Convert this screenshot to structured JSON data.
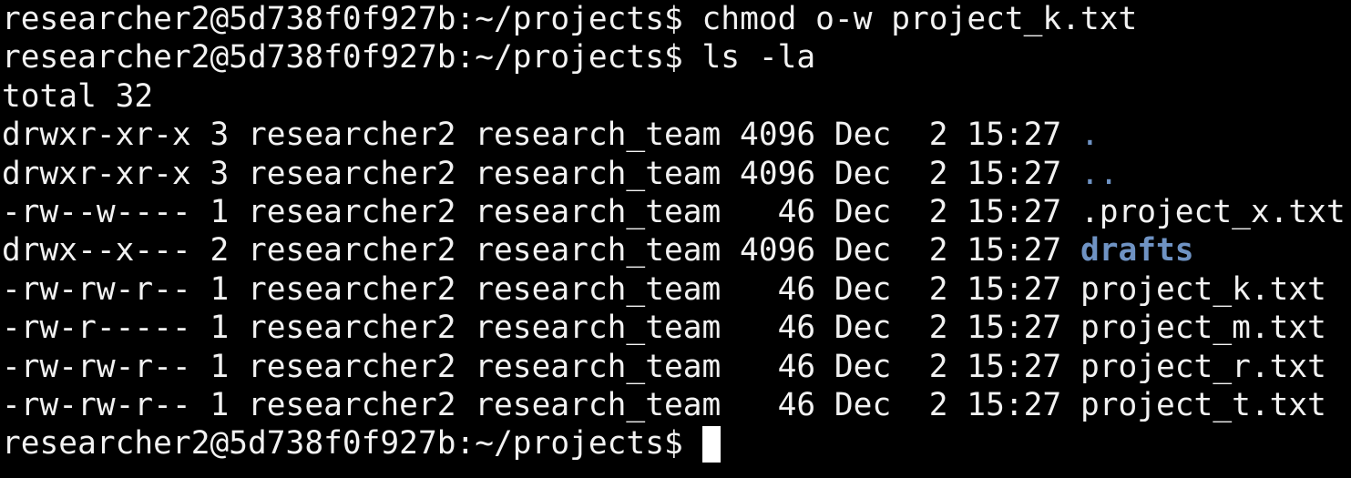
{
  "terminal": {
    "prompt": "researcher2@5d738f0f927b:~/projects$ ",
    "history": [
      {
        "command": "chmod o-w project_k.txt"
      },
      {
        "command": "ls -la"
      }
    ],
    "total_line": "total 32",
    "listing": [
      {
        "prefix": "drwxr-xr-x 3 researcher2 research_team 4096 Dec  2 15:27 ",
        "name": "."
      },
      {
        "prefix": "drwxr-xr-x 3 researcher2 research_team 4096 Dec  2 15:27 ",
        "name": ".."
      },
      {
        "prefix": "-rw--w---- 1 researcher2 research_team   46 Dec  2 15:27 ",
        "name": ".project_x.txt"
      },
      {
        "prefix": "drwx--x--- 2 researcher2 research_team 4096 Dec  2 15:27 ",
        "name": "drafts"
      },
      {
        "prefix": "-rw-rw-r-- 1 researcher2 research_team   46 Dec  2 15:27 ",
        "name": "project_k.txt"
      },
      {
        "prefix": "-rw-r----- 1 researcher2 research_team   46 Dec  2 15:27 ",
        "name": "project_m.txt"
      },
      {
        "prefix": "-rw-rw-r-- 1 researcher2 research_team   46 Dec  2 15:27 ",
        "name": "project_r.txt"
      },
      {
        "prefix": "-rw-rw-r-- 1 researcher2 research_team   46 Dec  2 15:27 ",
        "name": "project_t.txt"
      }
    ],
    "colors": {
      "background": "#000000",
      "foreground": "#f2f2f2",
      "directory": "#6f93c4",
      "cursor": "#ffffff"
    }
  }
}
